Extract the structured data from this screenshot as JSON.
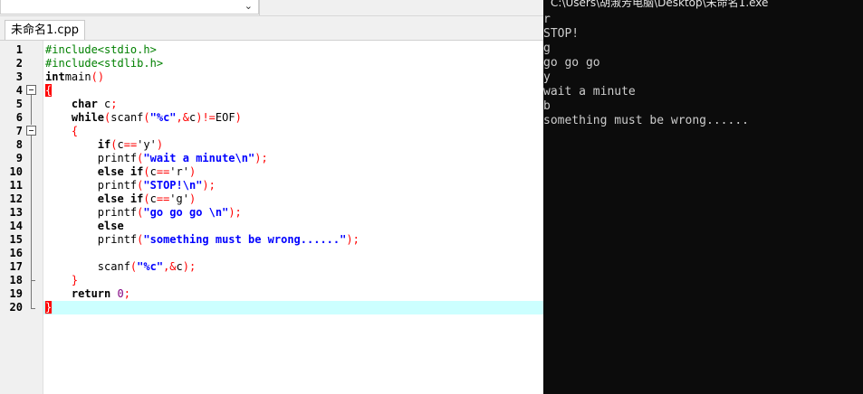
{
  "toolbar": {
    "dropdown_icon": "chevron-down-icon"
  },
  "tab": {
    "label": "未命名1.cpp"
  },
  "editor": {
    "current_line": 20,
    "lines": [
      {
        "n": "1",
        "segs": [
          [
            "pp",
            "#include<stdio.h>"
          ]
        ]
      },
      {
        "n": "2",
        "segs": [
          [
            "pp",
            "#include<stdlib.h>"
          ]
        ]
      },
      {
        "n": "3",
        "segs": [
          [
            "kw",
            "int"
          ],
          [
            "",
            "main"
          ],
          [
            "sym",
            "()"
          ]
        ]
      },
      {
        "n": "4",
        "segs": [
          [
            "brace-hl",
            "{"
          ]
        ]
      },
      {
        "n": "5",
        "segs": [
          [
            "",
            "    "
          ],
          [
            "kw",
            "char"
          ],
          [
            "",
            " c"
          ],
          [
            "sym",
            ";"
          ]
        ]
      },
      {
        "n": "6",
        "segs": [
          [
            "",
            "    "
          ],
          [
            "kw",
            "while"
          ],
          [
            "sym",
            "("
          ],
          [
            "",
            "scanf"
          ],
          [
            "sym",
            "("
          ],
          [
            "str",
            "\"%c\""
          ],
          [
            "sym",
            ",&"
          ],
          [
            "",
            "c"
          ],
          [
            "sym",
            ")!="
          ],
          [
            "",
            "EOF"
          ],
          [
            "sym",
            ")"
          ]
        ]
      },
      {
        "n": "7",
        "segs": [
          [
            "",
            "    "
          ],
          [
            "sym",
            "{"
          ]
        ]
      },
      {
        "n": "8",
        "segs": [
          [
            "",
            "        "
          ],
          [
            "kw",
            "if"
          ],
          [
            "sym",
            "("
          ],
          [
            "",
            "c"
          ],
          [
            "sym",
            "=="
          ],
          [
            "",
            "'y'"
          ],
          [
            "sym",
            ")"
          ]
        ]
      },
      {
        "n": "9",
        "segs": [
          [
            "",
            "        printf"
          ],
          [
            "sym",
            "("
          ],
          [
            "str",
            "\"wait a minute\\n\""
          ],
          [
            "sym",
            ");"
          ]
        ]
      },
      {
        "n": "10",
        "segs": [
          [
            "",
            "        "
          ],
          [
            "kw",
            "else if"
          ],
          [
            "sym",
            "("
          ],
          [
            "",
            "c"
          ],
          [
            "sym",
            "=="
          ],
          [
            "",
            "'r'"
          ],
          [
            "sym",
            ")"
          ]
        ]
      },
      {
        "n": "11",
        "segs": [
          [
            "",
            "        printf"
          ],
          [
            "sym",
            "("
          ],
          [
            "str",
            "\"STOP!\\n\""
          ],
          [
            "sym",
            ");"
          ]
        ]
      },
      {
        "n": "12",
        "segs": [
          [
            "",
            "        "
          ],
          [
            "kw",
            "else if"
          ],
          [
            "sym",
            "("
          ],
          [
            "",
            "c"
          ],
          [
            "sym",
            "=="
          ],
          [
            "",
            "'g'"
          ],
          [
            "sym",
            ")"
          ]
        ]
      },
      {
        "n": "13",
        "segs": [
          [
            "",
            "        printf"
          ],
          [
            "sym",
            "("
          ],
          [
            "str",
            "\"go go go \\n\""
          ],
          [
            "sym",
            ");"
          ]
        ]
      },
      {
        "n": "14",
        "segs": [
          [
            "",
            "        "
          ],
          [
            "kw",
            "else"
          ]
        ]
      },
      {
        "n": "15",
        "segs": [
          [
            "",
            "        printf"
          ],
          [
            "sym",
            "("
          ],
          [
            "str",
            "\"something must be wrong......\""
          ],
          [
            "sym",
            ");"
          ]
        ]
      },
      {
        "n": "16",
        "segs": []
      },
      {
        "n": "17",
        "segs": [
          [
            "",
            "        scanf"
          ],
          [
            "sym",
            "("
          ],
          [
            "str",
            "\"%c\""
          ],
          [
            "sym",
            ",&"
          ],
          [
            "",
            "c"
          ],
          [
            "sym",
            ");"
          ]
        ]
      },
      {
        "n": "18",
        "segs": [
          [
            "",
            "    "
          ],
          [
            "sym",
            "}"
          ]
        ]
      },
      {
        "n": "19",
        "segs": [
          [
            "",
            "    "
          ],
          [
            "kw",
            "return"
          ],
          [
            "",
            " "
          ],
          [
            "num",
            "0"
          ],
          [
            "sym",
            ";"
          ]
        ]
      },
      {
        "n": "20",
        "segs": [
          [
            "brace-hl",
            "}"
          ]
        ]
      }
    ]
  },
  "console": {
    "title": "C:\\Users\\胡淑芳电脑\\Desktop\\未命名1.exe",
    "lines": [
      "r",
      "STOP!",
      "g",
      "go go go",
      "y",
      "wait a minute",
      "b",
      "something must be wrong......"
    ]
  }
}
